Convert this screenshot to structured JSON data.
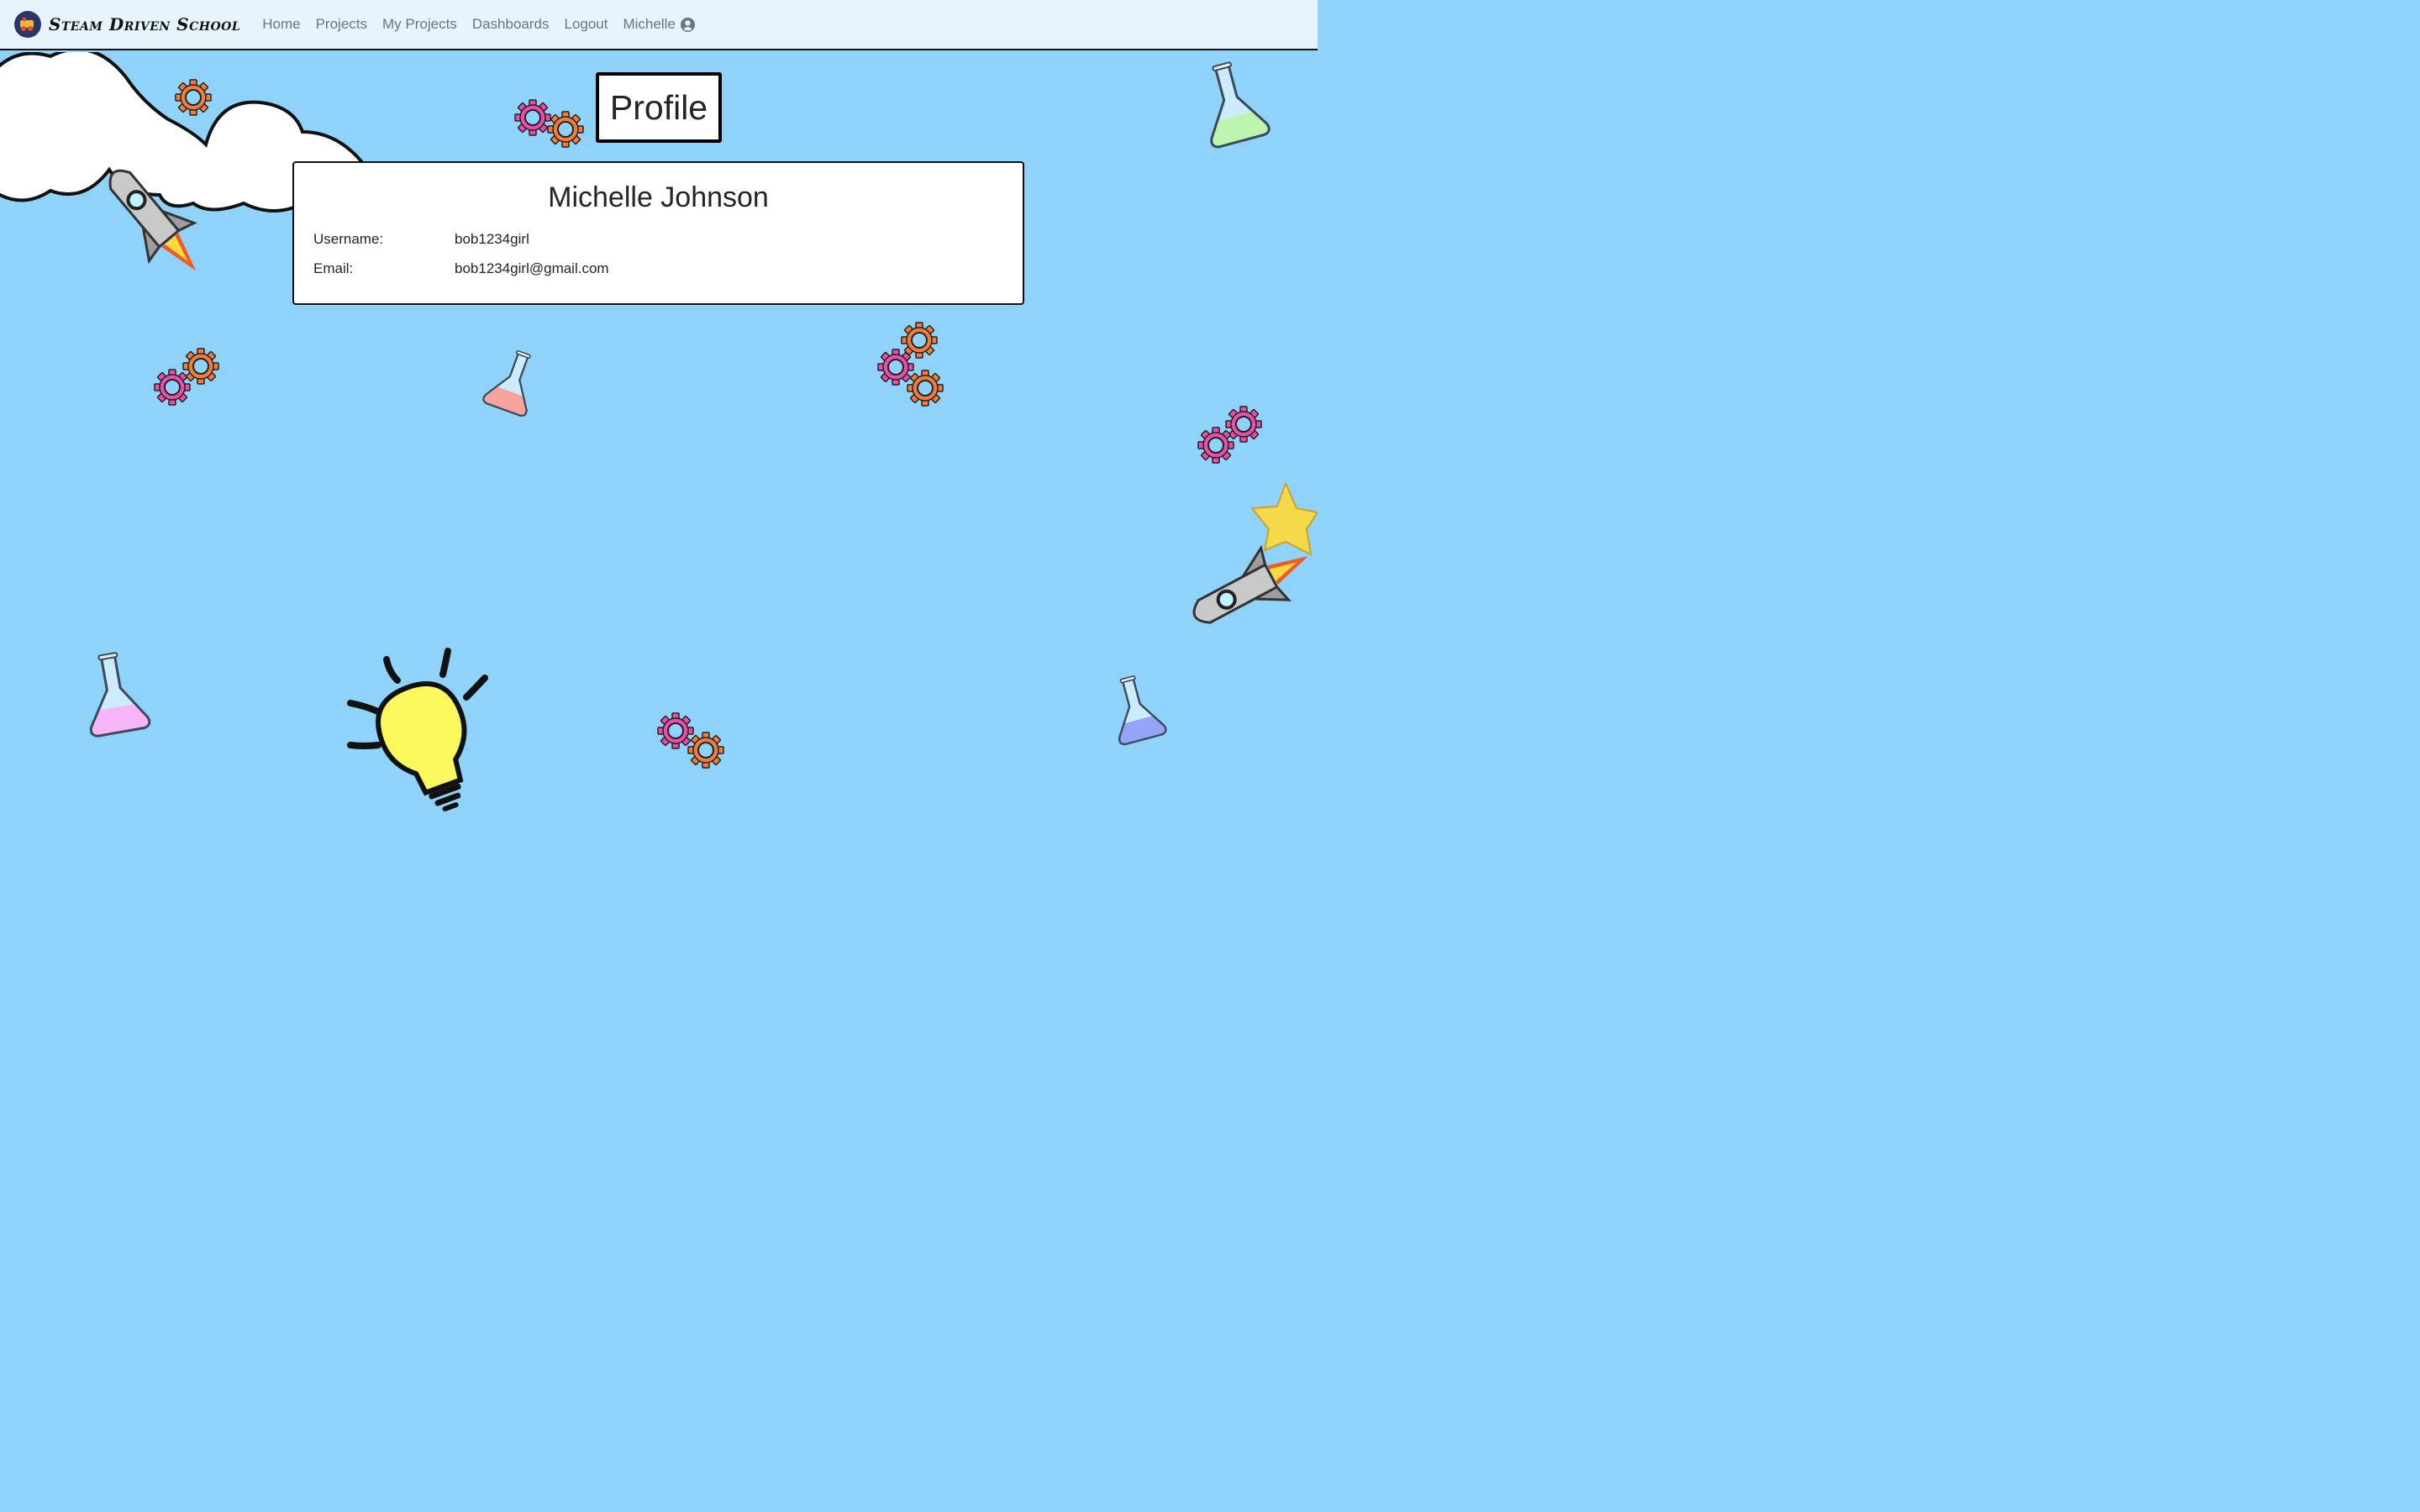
{
  "navbar": {
    "brand": "Steam Driven School",
    "links": [
      "Home",
      "Projects",
      "My Projects",
      "Dashboards",
      "Logout"
    ],
    "user_name": "Michelle",
    "user_icon": "user-circle-icon"
  },
  "page": {
    "title": "Profile"
  },
  "profile": {
    "full_name": "Michelle Johnson",
    "username_label": "Username:",
    "username": "bob1234girl",
    "email_label": "Email:",
    "email": "bob1234girl@gmail.com"
  },
  "colors": {
    "background": "#8fd3fa",
    "navbar": "#e7f3fd",
    "gear_orange": "#f07d3b",
    "gear_pink": "#e94fa7"
  }
}
